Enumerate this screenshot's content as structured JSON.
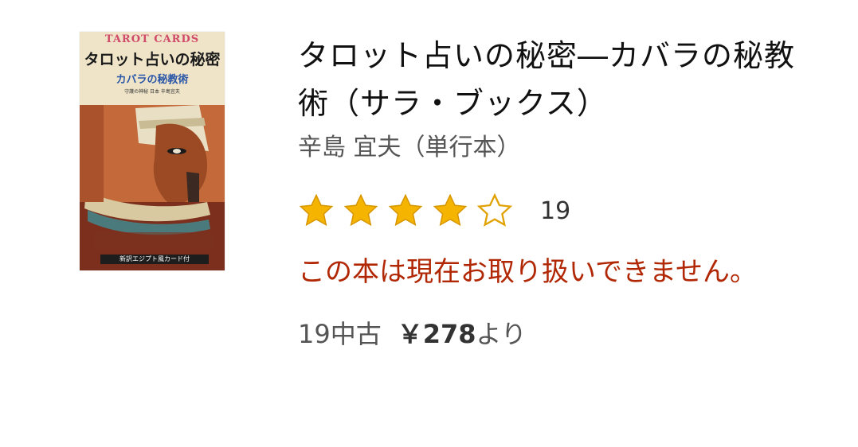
{
  "book": {
    "cover": {
      "top_text": "TAROT CARDS",
      "title": "タロット占いの秘密",
      "subtitle": "カバラの秘教術",
      "small_text": "守護の神秘 日本 辛島宜夫",
      "band_text": "新訳エジプト風カード付"
    },
    "title": "タロット占いの秘密―カバラの秘教術（サラ・ブックス）",
    "author": "辛島 宜夫（単行本）",
    "rating": {
      "stars": 4,
      "max_stars": 5,
      "count": "19"
    },
    "availability": "この本は現在お取り扱いできません。",
    "offer": {
      "used_count": "19中古",
      "price": "￥278",
      "suffix": "より"
    }
  },
  "colors": {
    "availability": "#b12704",
    "star_fill": "#f4b400",
    "star_outline": "#e1a100"
  }
}
